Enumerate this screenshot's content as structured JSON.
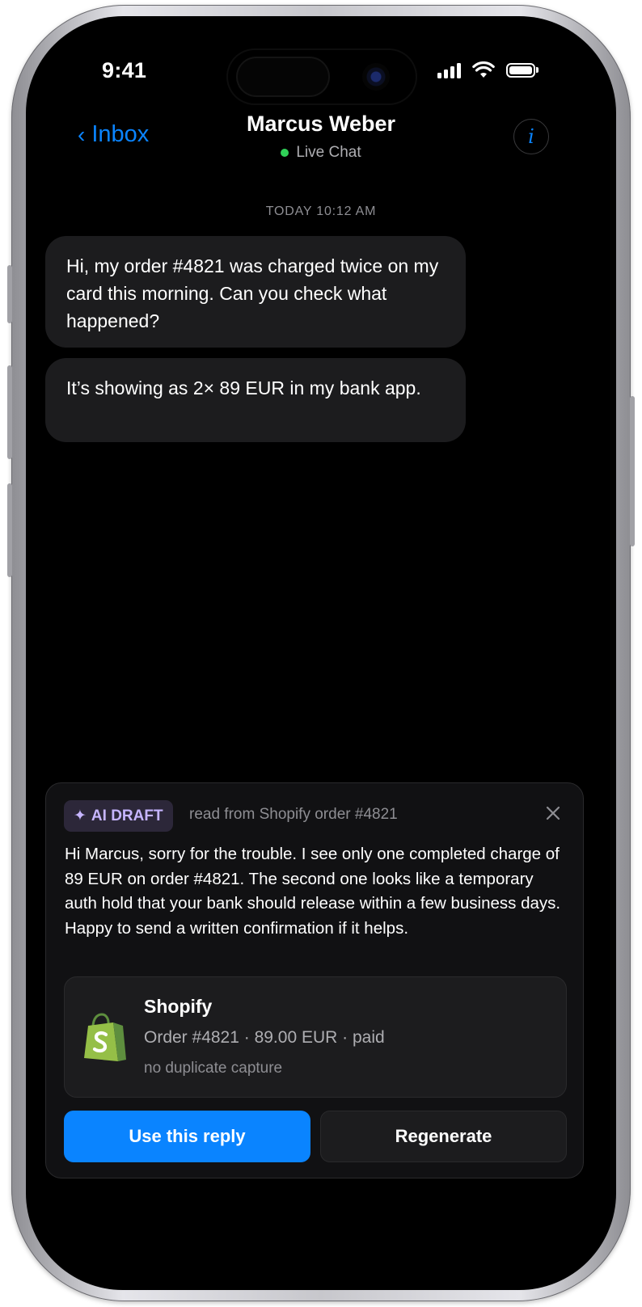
{
  "status_bar": {
    "time": "9:41"
  },
  "nav": {
    "back_label": "Inbox",
    "back_chevron": "‹",
    "title": "Marcus Weber",
    "subtitle": "Live Chat",
    "info_label": "i",
    "live_color": "#30d158",
    "accent_color": "#0a84ff"
  },
  "chat": {
    "timestamp": "TODAY 10:12 AM",
    "messages": [
      {
        "text": "Hi, my order #4821 was charged twice on my card this morning. Can you check what happened?"
      },
      {
        "text": "It’s showing as 2× 89 EUR in my bank app."
      }
    ]
  },
  "draft": {
    "badge_icon": "✦",
    "badge_label": "AI DRAFT",
    "source": "read from Shopify order #4821",
    "body": "Hi Marcus, sorry for the trouble. I see only one completed charge of 89 EUR on order #4821. The second one looks like a temporary auth hold that your bank should release within a few business days. Happy to send a written confirmation if it helps.",
    "shopify": {
      "name": "Shopify",
      "order_line": "Order #4821 · 89.00 EUR · paid",
      "note": "no duplicate capture",
      "brand_color": "#95bf47"
    },
    "use_reply_label": "Use this reply",
    "regenerate_label": "Regenerate"
  }
}
